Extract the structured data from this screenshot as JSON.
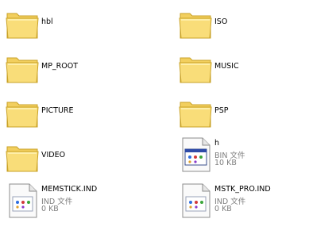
{
  "items": [
    {
      "kind": "folder",
      "name": "hbl",
      "icon": "folder-icon"
    },
    {
      "kind": "folder",
      "name": "ISO",
      "icon": "folder-icon"
    },
    {
      "kind": "folder",
      "name": "MP_ROOT",
      "icon": "folder-icon"
    },
    {
      "kind": "folder",
      "name": "MUSIC",
      "icon": "folder-icon"
    },
    {
      "kind": "folder",
      "name": "PICTURE",
      "icon": "folder-icon"
    },
    {
      "kind": "folder",
      "name": "PSP",
      "icon": "folder-icon"
    },
    {
      "kind": "folder",
      "name": "VIDEO",
      "icon": "folder-icon"
    },
    {
      "kind": "file",
      "name": "h",
      "type": "BIN 文件",
      "size": "10 KB",
      "icon": "application-window-icon"
    },
    {
      "kind": "file",
      "name": "MEMSTICK.IND",
      "type": "IND 文件",
      "size": "0 KB",
      "icon": "generic-file-icon"
    },
    {
      "kind": "file",
      "name": "MSTK_PRO.IND",
      "type": "IND 文件",
      "size": "0 KB",
      "icon": "generic-file-icon"
    }
  ],
  "colors": {
    "folder": "#f7d76a",
    "folder_edge": "#c9a227",
    "meta_text": "#7f7f7f"
  }
}
